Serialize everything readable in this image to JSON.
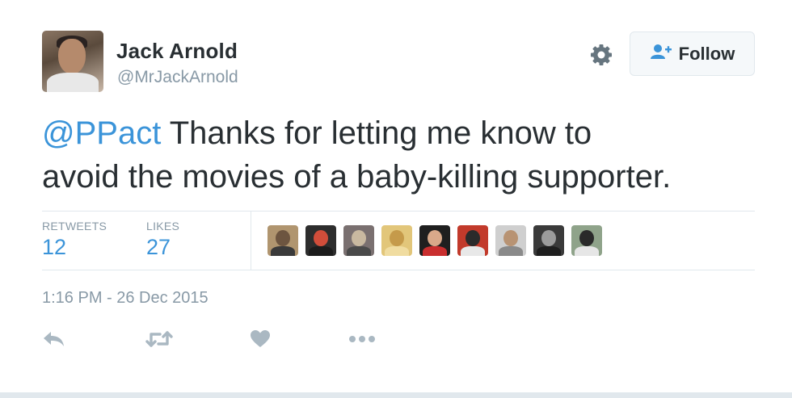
{
  "user": {
    "name": "Jack Arnold",
    "handle": "@MrJackArnold"
  },
  "follow_button": {
    "label": "Follow",
    "icon": "add-user-icon"
  },
  "settings_icon": "gear-icon",
  "tweet": {
    "mention": "@PPact",
    "text": " Thanks for letting me know to\navoid the movies of a baby-killing supporter."
  },
  "stats": {
    "retweets_label": "RETWEETS",
    "retweets_value": "12",
    "likes_label": "LIKES",
    "likes_value": "27"
  },
  "likers": [
    {
      "name": "liker-avatar-1",
      "bg": "#b0956f",
      "fg": "#6d5540",
      "body": "#3a3a3a"
    },
    {
      "name": "liker-avatar-2",
      "bg": "#2d2d2d",
      "fg": "#d14d3a",
      "body": "#1c1c1c"
    },
    {
      "name": "liker-avatar-3",
      "bg": "#7a7070",
      "fg": "#c9b9a0",
      "body": "#4a4a4a"
    },
    {
      "name": "liker-avatar-4",
      "bg": "#e2c67a",
      "fg": "#c59a4a",
      "body": "#f0dca0"
    },
    {
      "name": "liker-avatar-5",
      "bg": "#1f1f1f",
      "fg": "#d9a98a",
      "body": "#c92e2e"
    },
    {
      "name": "liker-avatar-6",
      "bg": "#c23a2b",
      "fg": "#2b2b2b",
      "body": "#e8e8e8"
    },
    {
      "name": "liker-avatar-7",
      "bg": "#cfcfcf",
      "fg": "#b89373",
      "body": "#8a8a8a"
    },
    {
      "name": "liker-avatar-8",
      "bg": "#3a3a3a",
      "fg": "#9c9c9c",
      "body": "#1e1e1e"
    },
    {
      "name": "liker-avatar-9",
      "bg": "#8fa38a",
      "fg": "#2a2a2a",
      "body": "#e6e6e6"
    }
  ],
  "timestamp": "1:16 PM - 26 Dec 2015",
  "actions": [
    {
      "name": "reply-icon"
    },
    {
      "name": "retweet-icon"
    },
    {
      "name": "like-icon"
    },
    {
      "name": "more-icon"
    }
  ],
  "colors": {
    "text": "#292f33",
    "muted": "#8899a6",
    "link": "#3b94d9",
    "border": "#e1e8ed",
    "icon": "#aab8c2"
  }
}
